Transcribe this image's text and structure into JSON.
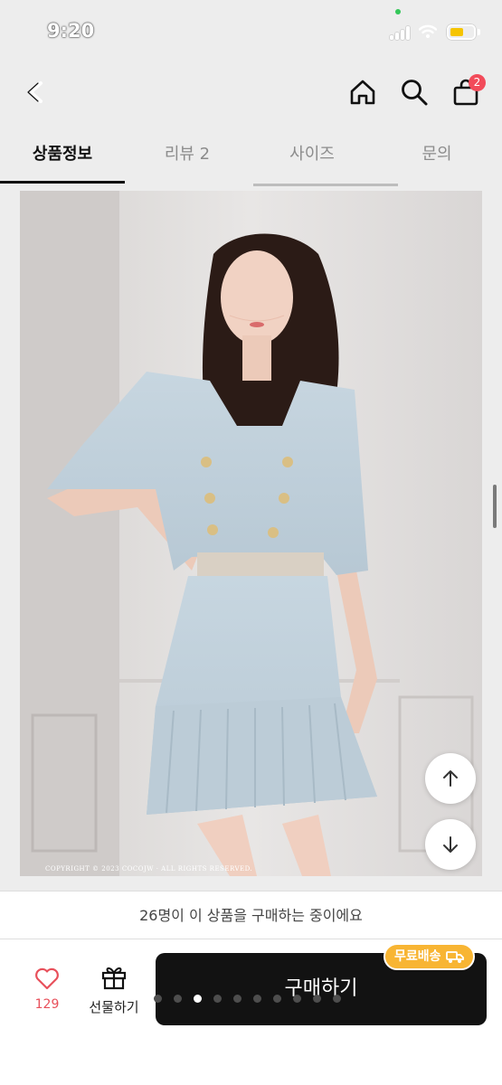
{
  "status_bar": {
    "time": "9:20"
  },
  "header": {
    "back_icon": "back-chevron-icon",
    "home_icon": "home-icon",
    "search_icon": "search-icon",
    "cart_icon": "shopping-bag-icon",
    "cart_count": "2"
  },
  "tabs": [
    {
      "label": "상품정보",
      "active": true
    },
    {
      "label": "리뷰 2",
      "active": false
    },
    {
      "label": "사이즈",
      "active": false
    },
    {
      "label": "문의",
      "active": false
    }
  ],
  "product_image": {
    "copyright": "COPYRIGHT © 2023 COCOJW · ALL RIGHTS RESERVED."
  },
  "floating_buttons": {
    "scroll_up_icon": "arrow-up-icon",
    "scroll_down_icon": "arrow-down-icon"
  },
  "purchase_notice": "26명이 이 상품을 구매하는 중이에요",
  "bottom_bar": {
    "like_count": "129",
    "gift_label": "선물하기",
    "buy_label": "구매하기",
    "free_shipping_label": "무료배송"
  },
  "colors": {
    "accent_badge": "#f24b5a",
    "heart": "#e8505b",
    "shipping_badge": "#f8b533",
    "buy_button": "#121212"
  }
}
